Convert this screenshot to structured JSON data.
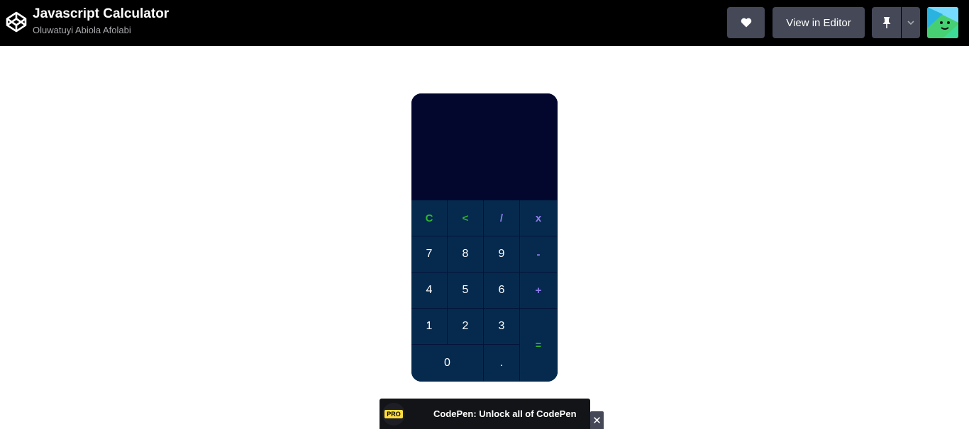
{
  "header": {
    "title": "Javascript Calculator",
    "author": "Oluwatuyi Abiola Afolabi",
    "view_in_editor": "View in Editor",
    "icons": [
      "codepen-logo-icon",
      "heart-icon",
      "pin-icon",
      "chevron-down-icon",
      "avatar"
    ]
  },
  "calculator": {
    "display_value": "",
    "keys": {
      "clear": "C",
      "back": "<",
      "divide": "/",
      "multiply": "x",
      "seven": "7",
      "eight": "8",
      "nine": "9",
      "minus": "-",
      "four": "4",
      "five": "5",
      "six": "6",
      "plus": "+",
      "one": "1",
      "two": "2",
      "three": "3",
      "equals": "=",
      "zero": "0",
      "dot": "."
    },
    "colors": {
      "display_bg": "#03072e",
      "key_bg": "#062a4e",
      "green": "#2eb82e",
      "purple": "#8f7df0"
    }
  },
  "promo": {
    "badge": "PRO",
    "text": "CodePen: Unlock all of CodePen",
    "close": "✕"
  }
}
